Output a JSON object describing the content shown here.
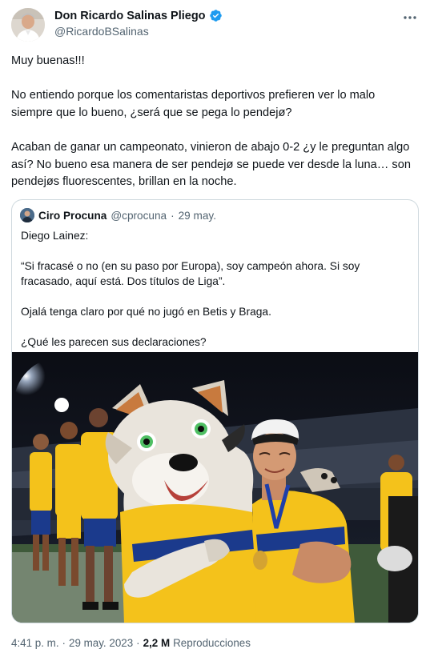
{
  "author": {
    "display_name": "Don Ricardo Salinas Pliego",
    "handle": "@RicardoBSalinas",
    "verified_color": "#1d9bf0"
  },
  "tweet": {
    "paragraphs": [
      "Muy buenas!!!",
      "No entiendo porque los comentaristas deportivos prefieren ver lo malo siempre que lo bueno, ¿será que se pega lo pendejø?",
      "Acaban de ganar un campeonato, vinieron de abajo 0-2 ¿y le preguntan algo así? No bueno esa manera de ser pendejø se puede ver desde la luna… son pendejøs fluorescentes, brillan en la noche."
    ]
  },
  "quote": {
    "display_name": "Ciro Procuna",
    "handle": "@cprocuna",
    "separator": "·",
    "date": "29 may.",
    "paragraphs": [
      "Diego Lainez:",
      "“Si fracasé o no (en su paso por Europa), soy campeón ahora. Si soy fracasado, aquí está. Dos títulos de Liga”.",
      "Ojalá tenga claro por qué no jugó en Betis y Braga.",
      "¿Qué les parecen sus declaraciones?"
    ],
    "media_description": "Tigres mascot posing with a player at night stadium celebration"
  },
  "footer": {
    "time": "4:41 p. m.",
    "separator1": "·",
    "date": "29 may. 2023",
    "separator2": "·",
    "views_count": "2,2 M",
    "views_label": "Reproducciones"
  },
  "colors": {
    "text": "#0f1419",
    "secondary": "#536471",
    "border": "#cfd9de",
    "tigres_yellow": "#f4c21b",
    "tigres_blue": "#1b3a8c"
  }
}
